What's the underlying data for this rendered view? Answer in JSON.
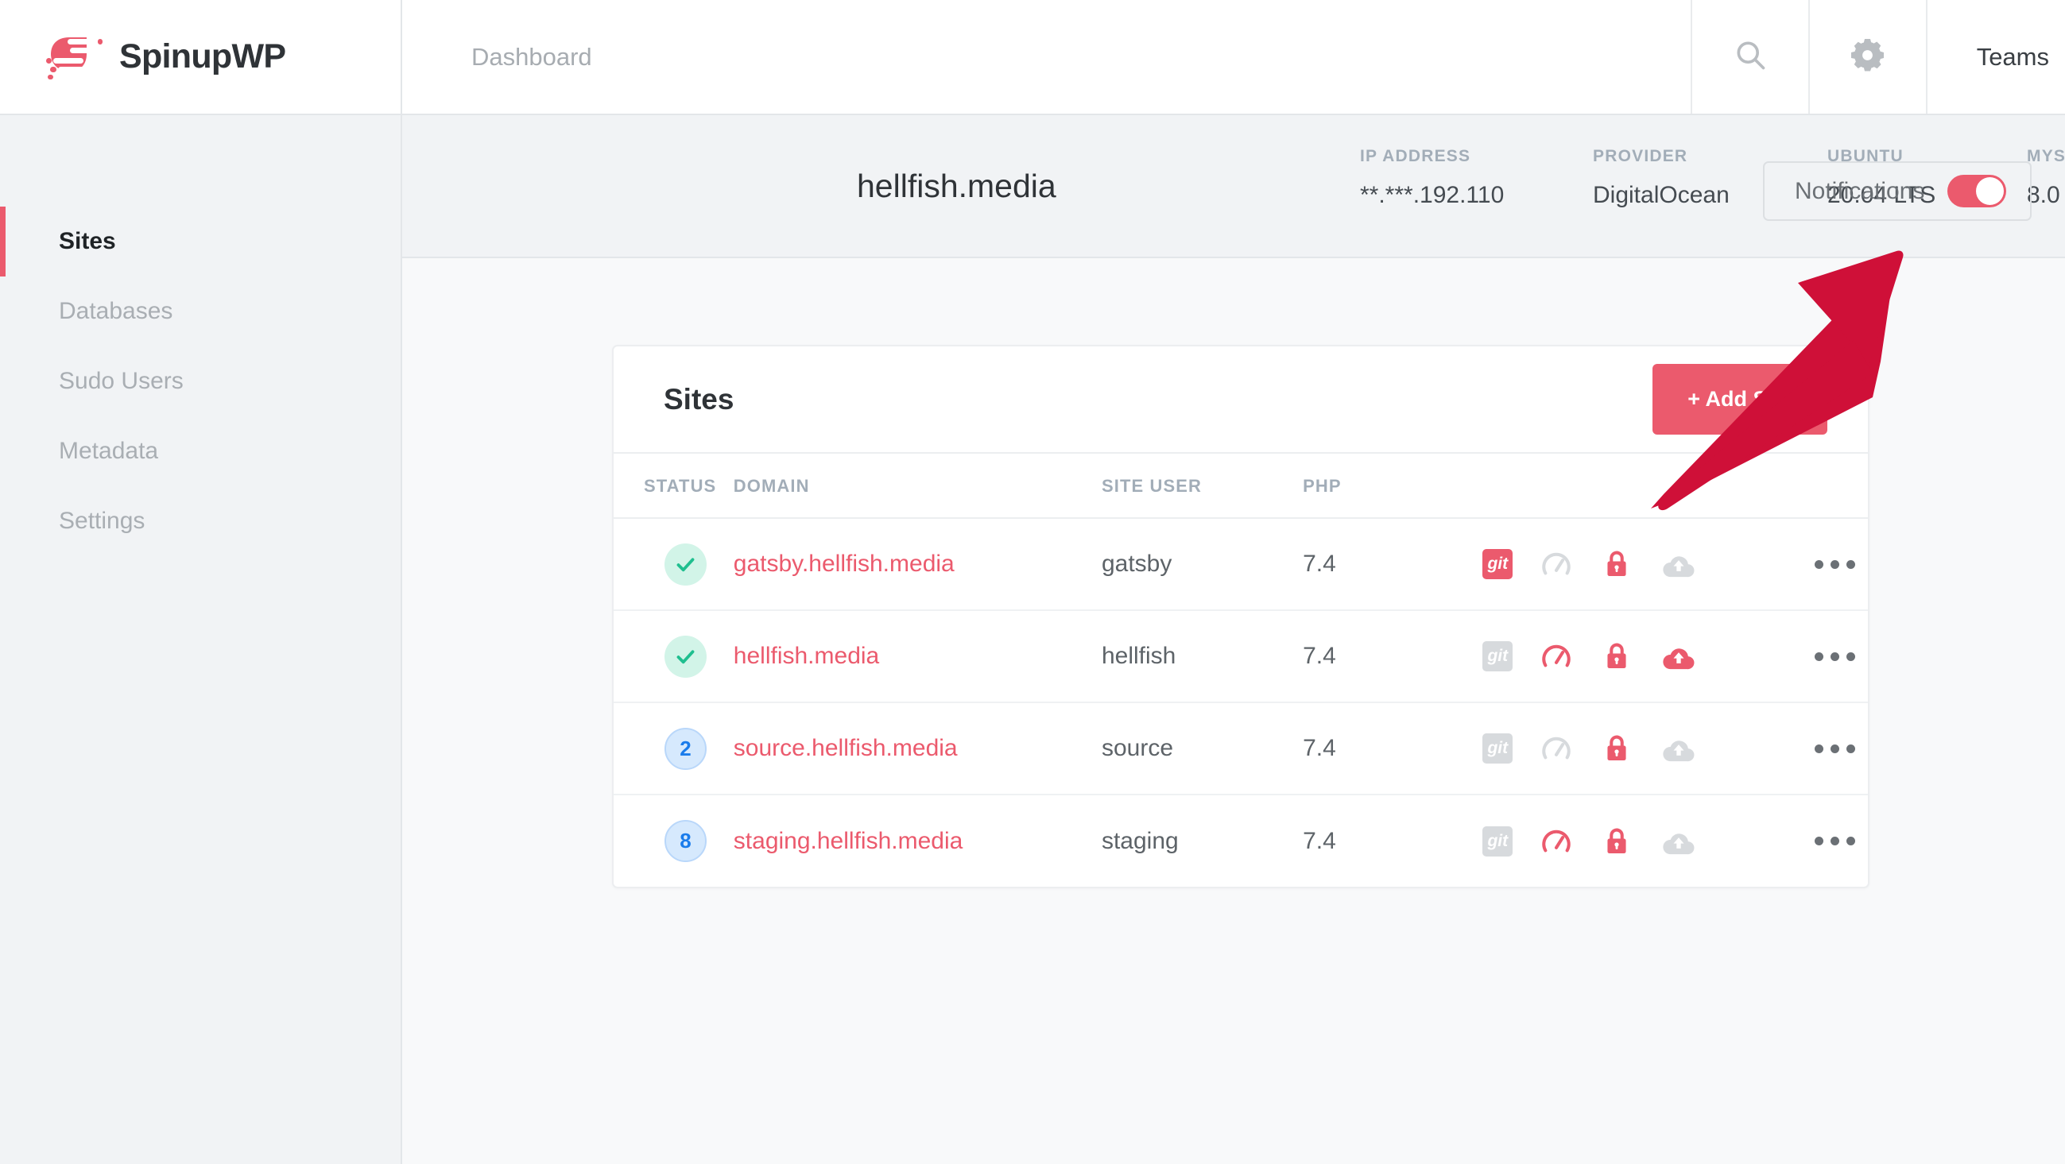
{
  "brand": {
    "name": "SpinupWP",
    "logo_icon": "spinupwp-swoosh-icon",
    "accent_color": "#eb5a6d"
  },
  "topbar": {
    "breadcrumb": "Dashboard",
    "search_icon": "search-icon",
    "settings_icon": "gears-icon",
    "teams_label": "Teams"
  },
  "sidebar": {
    "items": [
      {
        "label": "Sites",
        "active": true
      },
      {
        "label": "Databases",
        "active": false
      },
      {
        "label": "Sudo Users",
        "active": false
      },
      {
        "label": "Metadata",
        "active": false
      },
      {
        "label": "Settings",
        "active": false
      }
    ]
  },
  "server": {
    "title": "hellfish.media",
    "meta": [
      {
        "label": "IP ADDRESS",
        "value": "**.***.192.110"
      },
      {
        "label": "PROVIDER",
        "value": "DigitalOcean"
      },
      {
        "label": "UBUNTU",
        "value": "20.04 LTS"
      },
      {
        "label": "MYSQL",
        "value": "8.0"
      }
    ],
    "notifications": {
      "label": "Notifications",
      "state": "on"
    }
  },
  "sites_card": {
    "title": "Sites",
    "add_button": "+ Add Site",
    "columns": [
      "STATUS",
      "DOMAIN",
      "SITE USER",
      "PHP"
    ],
    "rows": [
      {
        "status_type": "ok",
        "status_value": "",
        "domain": "gatsby.hellfish.media",
        "site_user": "gatsby",
        "php": "7.4",
        "icons": {
          "git": "on",
          "cache": "off",
          "ssl": "on",
          "backup": "off"
        },
        "menu_icon": "ellipsis-icon"
      },
      {
        "status_type": "ok",
        "status_value": "",
        "domain": "hellfish.media",
        "site_user": "hellfish",
        "php": "7.4",
        "icons": {
          "git": "off",
          "cache": "on",
          "ssl": "on",
          "backup": "on"
        },
        "menu_icon": "ellipsis-icon"
      },
      {
        "status_type": "count",
        "status_value": "2",
        "domain": "source.hellfish.media",
        "site_user": "source",
        "php": "7.4",
        "icons": {
          "git": "off",
          "cache": "off",
          "ssl": "on",
          "backup": "off"
        },
        "menu_icon": "ellipsis-icon"
      },
      {
        "status_type": "count",
        "status_value": "8",
        "domain": "staging.hellfish.media",
        "site_user": "staging",
        "php": "7.4",
        "icons": {
          "git": "off",
          "cache": "on",
          "ssl": "on",
          "backup": "off"
        },
        "menu_icon": "ellipsis-icon"
      }
    ],
    "git_label": "git"
  },
  "annotation": {
    "arrow_icon": "pointer-arrow-icon",
    "arrow_color": "#cf1038",
    "points_to": "notifications-toggle"
  }
}
